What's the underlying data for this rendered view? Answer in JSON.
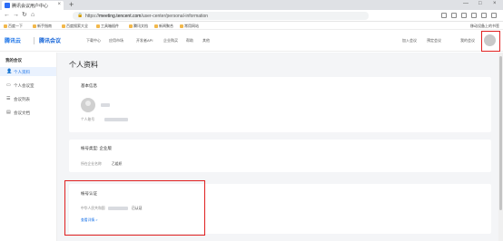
{
  "browser": {
    "tab_title": "腾讯会议用户中心",
    "tab_close": "×",
    "new_tab": "+",
    "window_controls": [
      "—",
      "□",
      "×"
    ],
    "url_prefix": "https://",
    "url_host": "meeting.tencent.com",
    "url_path": "/user-center/personal-information",
    "lock_icon": "🔒",
    "back": "←",
    "forward": "→",
    "reload": "↻",
    "home": "⌂"
  },
  "bookmarks": {
    "items": [
      "百度一下",
      "新手指南",
      "百度搜索大全",
      "工具箱插件",
      "腾讯文档",
      "新闻聚合",
      "常用网站"
    ],
    "right": "移动设备上的书签"
  },
  "header": {
    "logo_cloud": "腾讯云",
    "logo_meeting": "腾讯会议",
    "nav": [
      "下载中心",
      "应用市场",
      "开发者API",
      "企业购买",
      "帮助",
      "其他"
    ],
    "join_meeting": "加入会议",
    "schedule_meeting": "预定会议",
    "my_meetings": "我的会议"
  },
  "sidebar": {
    "section_title": "我的会议",
    "items": [
      {
        "icon": "👤",
        "label": "个人资料"
      },
      {
        "icon": "▭",
        "label": "个人会议室"
      },
      {
        "icon": "☰",
        "label": "会议列表"
      },
      {
        "icon": "▤",
        "label": "会议文档"
      }
    ]
  },
  "main": {
    "page_title": "个人资料",
    "basic_info": {
      "title": "基本信息",
      "account_label": "个人账号"
    },
    "account_type": {
      "title": "帐号类型: 企业版",
      "org_label": "所在企业名称",
      "org_value": "乙组织"
    },
    "auth": {
      "title": "帐号认证",
      "item_label": "中华人民共和国",
      "status": "已认证",
      "link": "查看详情 >"
    }
  },
  "colors": {
    "accent": "#1a73e8",
    "highlight_box": "#e02020",
    "page_bg": "#f4f5f7"
  }
}
